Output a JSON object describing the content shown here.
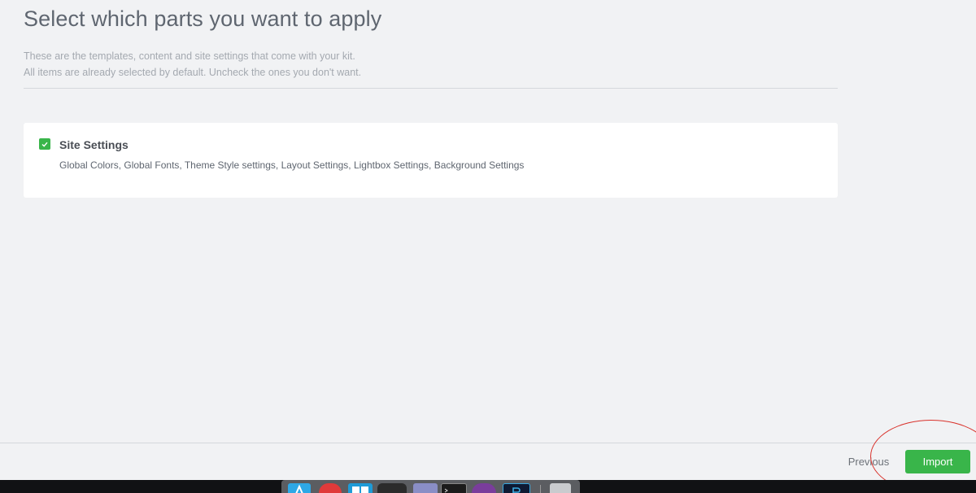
{
  "header": {
    "title": "Select which parts you want to apply",
    "description_line1": "These are the templates, content and site settings that come with your kit.",
    "description_line2": "All items are already selected by default. Uncheck the ones you don't want."
  },
  "parts": [
    {
      "title": "Site Settings",
      "description": "Global Colors, Global Fonts, Theme Style settings, Layout Settings, Lightbox Settings, Background Settings",
      "checked": true
    }
  ],
  "footer": {
    "previous_label": "Previous",
    "import_label": "Import"
  },
  "colors": {
    "accent_green": "#39b54a",
    "highlight_red": "#d9322b",
    "background": "#f1f2f4"
  },
  "dock": {
    "icons": [
      "appstore-icon",
      "vivaldi-icon",
      "window-manager-icon",
      "mission-control-icon",
      "box-icon",
      "terminal-icon",
      "github-icon",
      "photoshop-icon",
      "trash-icon"
    ]
  }
}
